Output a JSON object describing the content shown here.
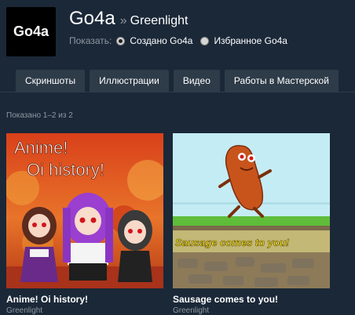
{
  "group": {
    "avatar_text": "Go4a",
    "name": "Go4a",
    "breadcrumb_sep": "»",
    "section": "Greenlight"
  },
  "filter": {
    "label": "Показать:",
    "options": [
      {
        "label": "Создано Go4a",
        "selected": true
      },
      {
        "label": "Избранное Go4a",
        "selected": false
      }
    ]
  },
  "tabs": [
    "Скриншоты",
    "Иллюстрации",
    "Видео",
    "Работы в Мастерской"
  ],
  "results_count": "Показано 1–2 из 2",
  "items": [
    {
      "title": "Anime! Oi history!",
      "type": "Greenlight",
      "art_text": [
        "Anime!",
        "Oi history!"
      ]
    },
    {
      "title": "Sausage comes to you!",
      "type": "Greenlight",
      "art_text": [
        "Sausage comes to you!"
      ]
    }
  ],
  "colors": {
    "background": "#1b2838",
    "tab_bg": "#2e3b48",
    "muted_text": "#8f98a0"
  }
}
